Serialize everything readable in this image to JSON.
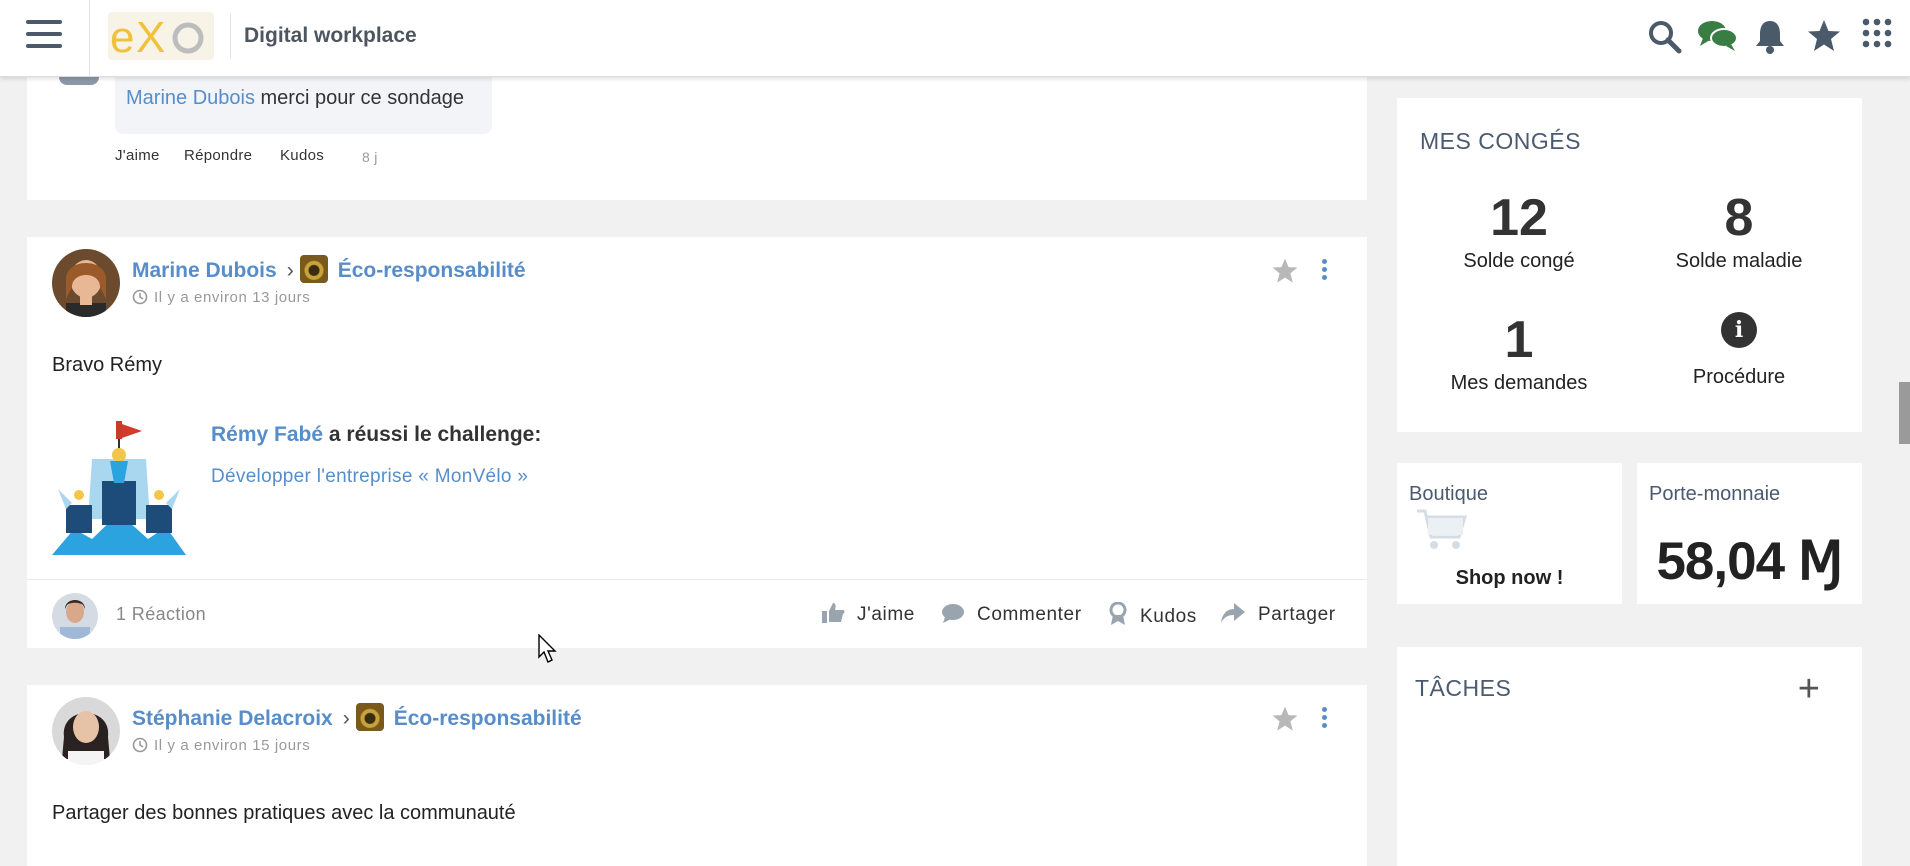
{
  "header": {
    "menu_icon": "hamburger-icon",
    "brand": "Digital workplace",
    "icons": [
      "search-icon",
      "chat-icon",
      "bell-icon",
      "star-icon",
      "apps-grid-icon"
    ],
    "colors": {
      "icon": "#4a5a6a",
      "chat": "#3a7d44",
      "link": "#578dc9"
    }
  },
  "feed": {
    "prev_comment": {
      "author": "Marine Dubois",
      "text": "merci pour ce sondage",
      "actions": {
        "like": "J'aime",
        "reply": "Répondre",
        "kudos": "Kudos"
      },
      "time": "8 j"
    },
    "posts": [
      {
        "author": "Marine Dubois",
        "space": "Éco-responsabilité",
        "time": "Il y a environ 13 jours",
        "text": "Bravo Rémy",
        "kudos": {
          "person": "Rémy Fabé",
          "title_rest": "a réussi le challenge:",
          "challenge": "Développer l'entreprise « MonVélo »"
        },
        "reactions": "1 Réaction",
        "actions": {
          "like": "J'aime",
          "comment": "Commenter",
          "kudos": "Kudos",
          "share": "Partager"
        }
      },
      {
        "author": "Stéphanie Delacroix",
        "space": "Éco-responsabilité",
        "time": "Il y a environ 15 jours",
        "text": "Partager des bonnes pratiques avec la communauté"
      }
    ]
  },
  "sidebar": {
    "conges": {
      "title": "MES CONGÉS",
      "solde_conge": {
        "value": "12",
        "label": "Solde congé"
      },
      "solde_maladie": {
        "value": "8",
        "label": "Solde maladie"
      },
      "demandes": {
        "value": "1",
        "label": "Mes demandes"
      },
      "procedure": {
        "label": "Procédure",
        "icon": "info-icon"
      }
    },
    "boutique": {
      "title": "Boutique",
      "cta": "Shop now !",
      "icon": "cart-icon"
    },
    "wallet": {
      "title": "Porte-monnaie",
      "amount": "58,04 Ɱ"
    },
    "taches": {
      "title": "TÂCHES",
      "add_icon": "plus-icon"
    }
  }
}
